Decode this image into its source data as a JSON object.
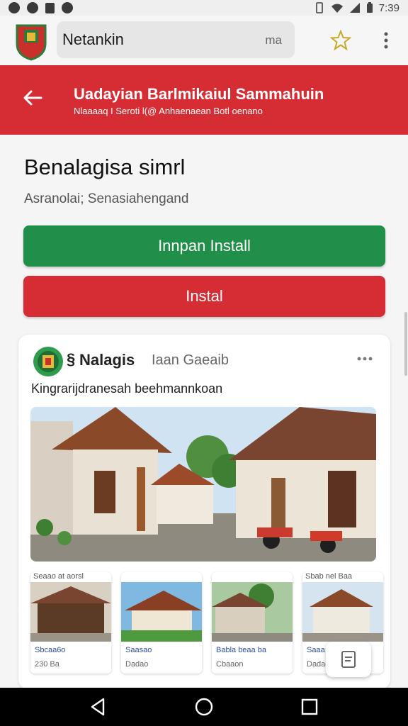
{
  "status_bar": {
    "time": "7:39"
  },
  "browser": {
    "url_text": "Netankin",
    "url_suffix": "ma",
    "icons": [
      "site-logo",
      "star-icon",
      "kebab-icon"
    ]
  },
  "header": {
    "title": "Uadayian Barlmikaiul Sammahuin",
    "subtitle": "Nlaaaaq I Seroti l(@ Anhaenaean Botl oenano"
  },
  "app": {
    "name": "Benalagisa simrl",
    "subtitle": "Asranolai; Senasiahengand"
  },
  "buttons": {
    "primary": "Innpan Install",
    "secondary": "Instal"
  },
  "card": {
    "mark": "§",
    "title": "Nalagis",
    "tag": "Iaan Gaeaib",
    "caption": "Kingrarijdranesah beehmannkoan",
    "thumbs": [
      {
        "head": "Seaao   at aorsl",
        "line1": "Sbcaa6o",
        "line2": "230 Ba"
      },
      {
        "head": "",
        "line1": "Saasao",
        "line2": "Dadao"
      },
      {
        "head": "",
        "line1": "Babla beaa ba",
        "line2": "Cbaaon"
      },
      {
        "head": "Sbab nel Baa",
        "line1": "Saaa ao",
        "line2": "Dadao"
      }
    ]
  },
  "colors": {
    "red": "#d52d33",
    "green": "#1f8f4a"
  }
}
